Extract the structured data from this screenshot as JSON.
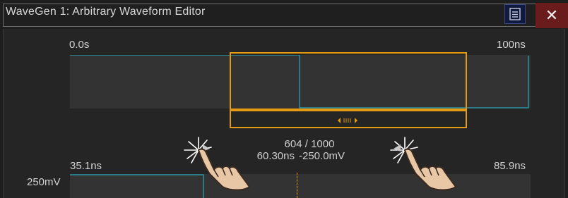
{
  "window": {
    "title": "WaveGen 1: Arbitrary Waveform Editor",
    "menu_icon": "list-icon",
    "close_label": "✕"
  },
  "overview": {
    "start_label": "0.0s",
    "end_label": "100ns",
    "scroll_handle_icon": "horizontal-scroll-handle-icon"
  },
  "detail": {
    "start_label": "35.1ns",
    "end_label": "85.9ns",
    "voltage_label": "250mV",
    "point_counter": "604 / 1000",
    "cursor_time": "60.30ns",
    "cursor_voltage": "-250.0mV"
  },
  "gestures": {
    "left_icon": "pinch-tap-left-icon",
    "right_icon": "pinch-tap-right-icon"
  },
  "colors": {
    "waveform": "#2aa6b8",
    "selection": "#e59a12",
    "close_bg": "#6a1c1c",
    "menu_bg": "#101a3e"
  }
}
